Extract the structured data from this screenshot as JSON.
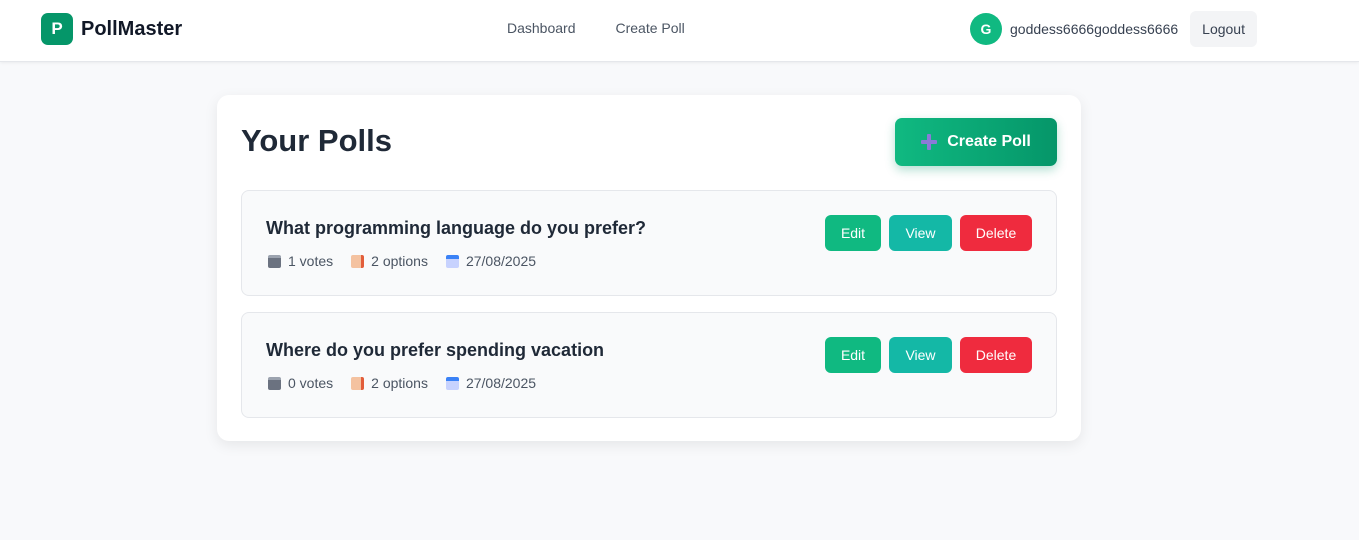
{
  "brand": {
    "logo_letter": "P",
    "name": "PollMaster"
  },
  "nav": {
    "items": [
      {
        "label": "Dashboard"
      },
      {
        "label": "Create Poll"
      }
    ]
  },
  "user": {
    "avatar_letter": "G",
    "username": "goddess6666goddess6666",
    "logout_label": "Logout"
  },
  "main": {
    "title": "Your Polls",
    "create_button_label": "Create Poll",
    "polls": [
      {
        "question": "What programming language do you prefer?",
        "votes": "1 votes",
        "options": "2 options",
        "date": "27/08/2025",
        "edit_label": "Edit",
        "view_label": "View",
        "delete_label": "Delete"
      },
      {
        "question": "Where do you prefer spending vacation",
        "votes": "0 votes",
        "options": "2 options",
        "date": "27/08/2025",
        "edit_label": "Edit",
        "view_label": "View",
        "delete_label": "Delete"
      }
    ]
  },
  "icons": {
    "votes": "clipboard-icon",
    "options": "memo-icon",
    "date": "calendar-icon",
    "create": "plus-icon"
  },
  "colors": {
    "brand": "#059669",
    "edit": "#10b981",
    "view": "#14b8a6",
    "delete": "#ef2b3e",
    "background": "#f8f9fb"
  }
}
